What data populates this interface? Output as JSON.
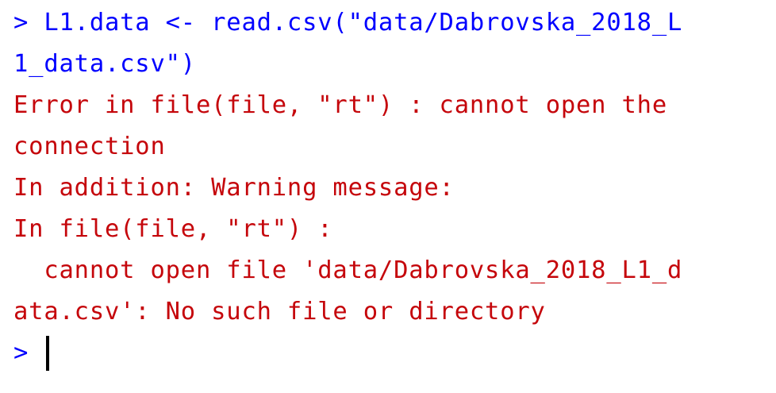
{
  "console": {
    "command_lines": [
      "> L1.data <- read.csv(\"data/Dabrovska_2018_L",
      "1_data.csv\")"
    ],
    "error_lines": [
      "Error in file(file, \"rt\") : cannot open the",
      "connection",
      "In addition: Warning message:",
      "In file(file, \"rt\") :",
      "  cannot open file 'data/Dabrovska_2018_L1_d",
      "ata.csv': No such file or directory"
    ],
    "prompt": ">",
    "colors": {
      "command": "#0000ff",
      "error": "#c5060b",
      "caret": "#000000",
      "background": "#ffffff"
    }
  }
}
